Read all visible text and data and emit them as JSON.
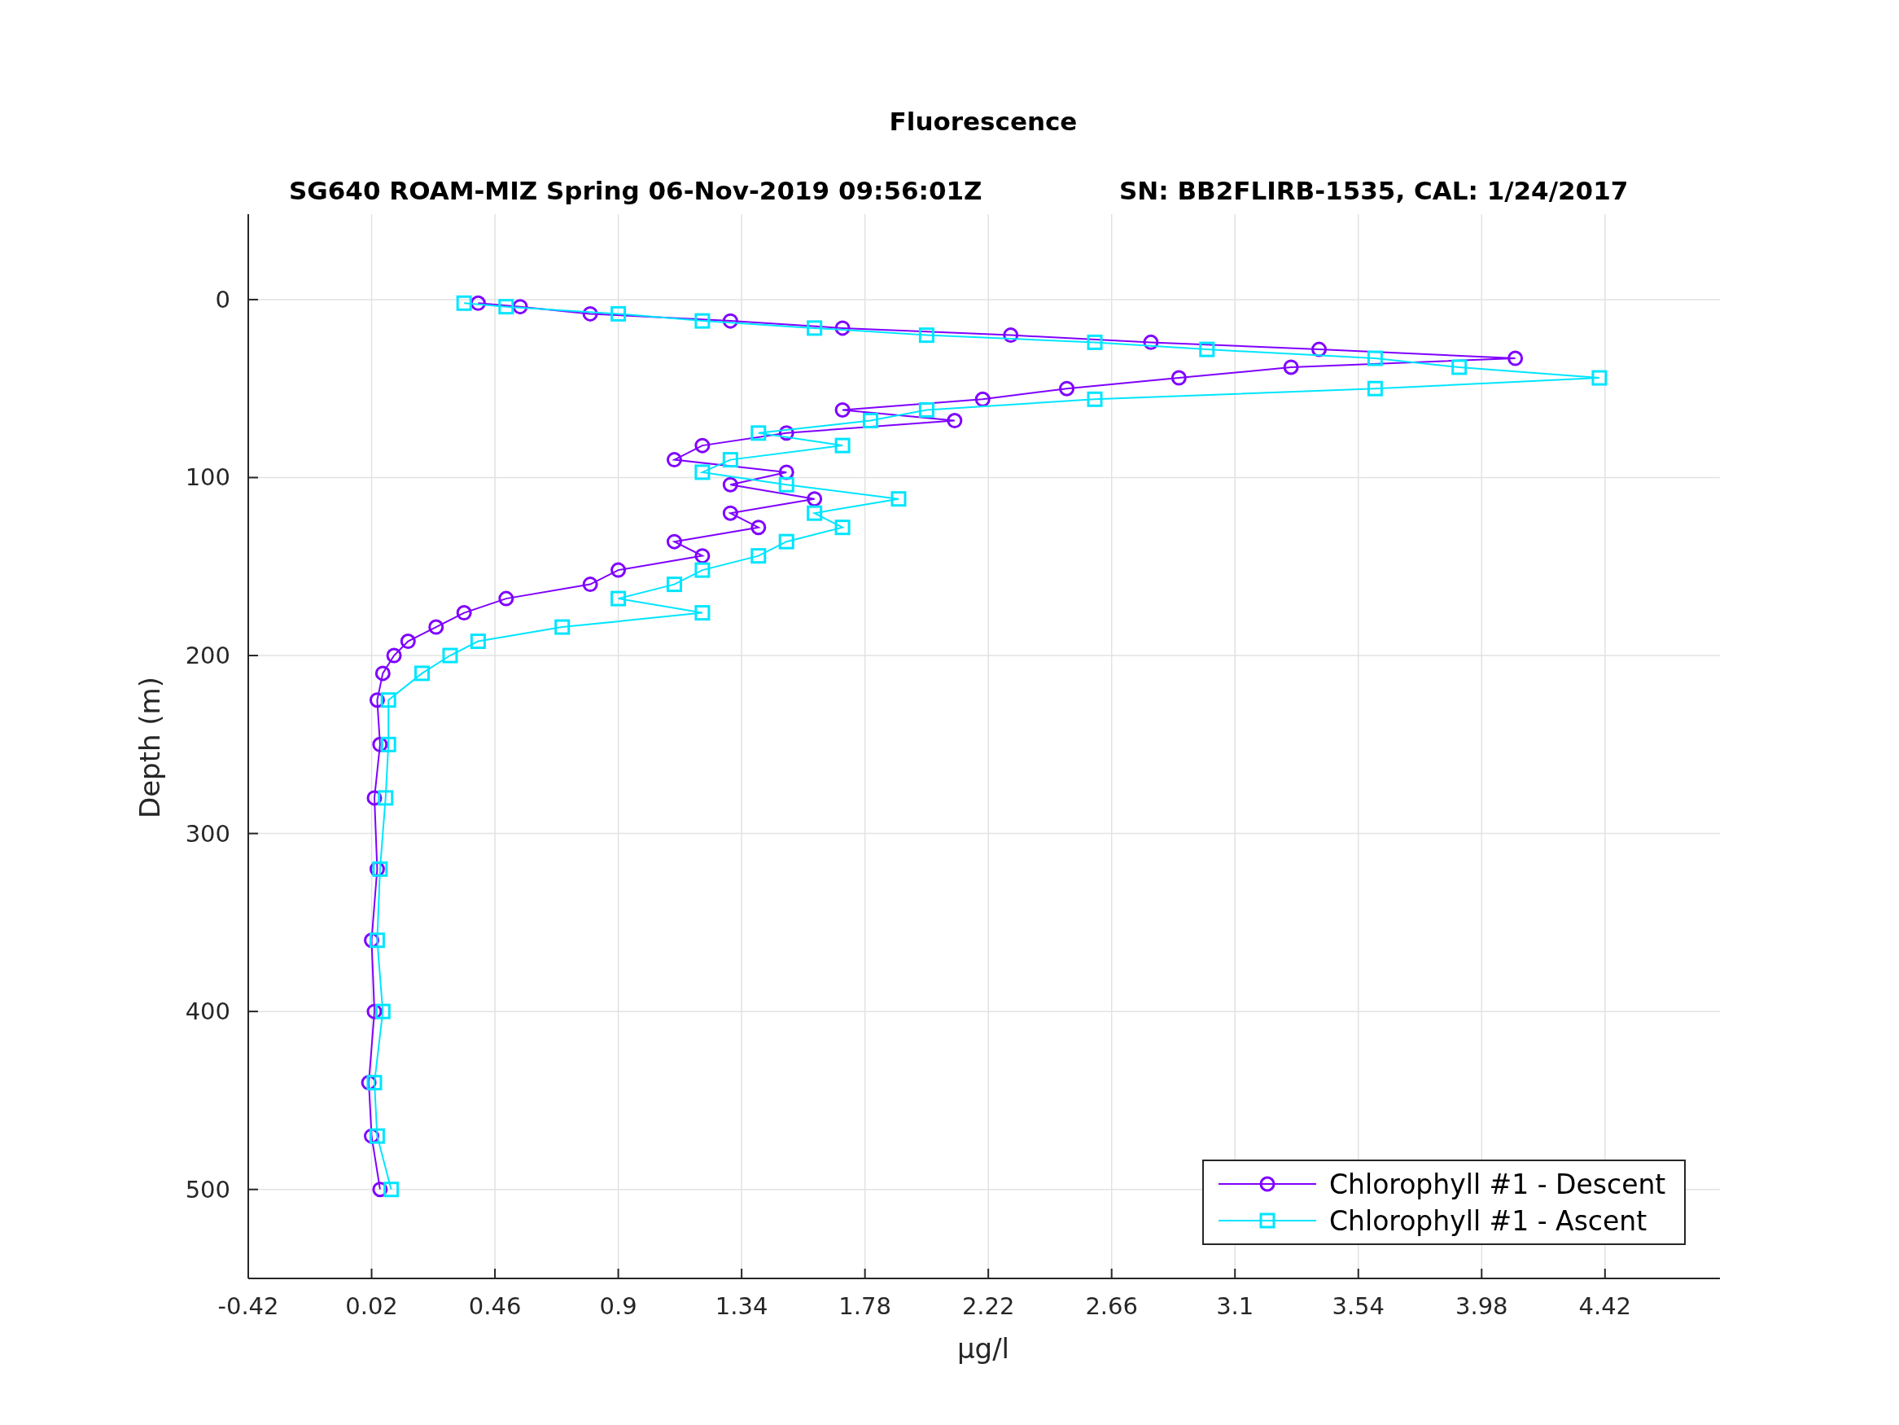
{
  "figure": {
    "title": "Fluorescence",
    "subtitle_left": "SG640 ROAM-MIZ Spring 06-Nov-2019 09:56:01Z",
    "subtitle_right": "SN: BB2FLIRB-1535, CAL: 1/24/2017",
    "chart_data": {
      "type": "line",
      "orientation": "horizontal",
      "xlabel": "μg/l",
      "ylabel": "Depth (m)",
      "x": [
        2,
        4,
        8,
        12,
        16,
        20,
        24,
        28,
        33,
        38,
        44,
        50,
        56,
        62,
        68,
        75,
        82,
        90,
        97,
        104,
        112,
        120,
        128,
        136,
        144,
        152,
        160,
        168,
        176,
        184,
        192,
        200,
        210,
        225,
        250,
        280,
        320,
        360,
        400,
        440,
        470,
        500
      ],
      "series": [
        {
          "name": "Chlorophyll #1 - Descent",
          "color": "#7f00ff",
          "marker": "circle",
          "values": [
            0.4,
            0.55,
            0.8,
            1.3,
            1.7,
            2.3,
            2.8,
            3.4,
            4.1,
            3.3,
            2.9,
            2.5,
            2.2,
            1.7,
            2.1,
            1.5,
            1.2,
            1.1,
            1.5,
            1.3,
            1.6,
            1.3,
            1.4,
            1.1,
            1.2,
            0.9,
            0.8,
            0.5,
            0.35,
            0.25,
            0.15,
            0.1,
            0.06,
            0.04,
            0.05,
            0.03,
            0.04,
            0.02,
            0.03,
            0.01,
            0.02,
            0.05
          ]
        },
        {
          "name": "Chlorophyll #1 - Ascent",
          "color": "#00e5ff",
          "marker": "square",
          "values": [
            0.35,
            0.5,
            0.9,
            1.2,
            1.6,
            2.0,
            2.6,
            3.0,
            3.6,
            3.9,
            4.4,
            3.6,
            2.6,
            2.0,
            1.8,
            1.4,
            1.7,
            1.3,
            1.2,
            1.5,
            1.9,
            1.6,
            1.7,
            1.5,
            1.4,
            1.2,
            1.1,
            0.9,
            1.2,
            0.7,
            0.4,
            0.3,
            0.2,
            0.08,
            0.08,
            0.07,
            0.05,
            0.04,
            0.06,
            0.03,
            0.04,
            0.09
          ]
        }
      ],
      "xlim": [
        -0.42,
        4.83
      ],
      "ylim": [
        550,
        -48
      ],
      "xticks": [
        -0.42,
        0.02,
        0.46,
        0.9,
        1.34,
        1.78,
        2.22,
        2.66,
        3.1,
        3.54,
        3.98,
        4.42
      ],
      "yticks": [
        0,
        100,
        200,
        300,
        400,
        500
      ],
      "grid": true,
      "legend": true
    }
  }
}
